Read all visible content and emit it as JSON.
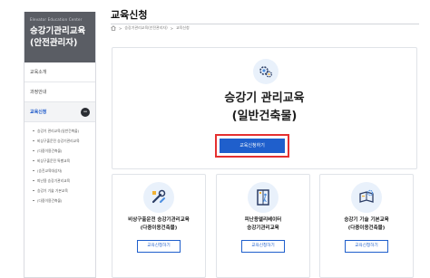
{
  "sidebar": {
    "subtitle": "Elevator Education Center",
    "title_line1": "승강기관리교육",
    "title_line2": "(안전관리자)",
    "items": [
      {
        "label": "교육소개"
      },
      {
        "label": "과정안내"
      },
      {
        "label": "교육신청",
        "toggle": "−"
      }
    ],
    "sub_items": [
      {
        "label": "승강기 관리교육(일반건축물)"
      },
      {
        "label": "비상구출운전 승강기관리교육"
      },
      {
        "label": "(다중이용건축물)"
      },
      {
        "label": "비상구출운전 특별교육"
      },
      {
        "label": "(승진교육대상자)"
      },
      {
        "label": "피난용 승강기관리교육"
      },
      {
        "label": "승강기 기술 기본교육"
      },
      {
        "label": "(다중이용건축물)"
      }
    ]
  },
  "header": {
    "title": "교육신청",
    "breadcrumb": [
      "승강기관리교육(안전관리자)",
      "교육신청"
    ],
    "breadcrumb_sep": ">"
  },
  "main": {
    "title_line1": "승강기 관리교육",
    "title_line2": "(일반건축물)",
    "button_label": "교육신청하기"
  },
  "cards": [
    {
      "title_line1": "비상구출운전 승강기관리교육",
      "title_line2": "(다중이용건축물)",
      "button_label": "교육신청하기",
      "icon": "elevator-repair-icon"
    },
    {
      "title_line1": "피난용엘리베이터",
      "title_line2": "승강기관리교육",
      "button_label": "교육신청하기",
      "icon": "evacuation-elevator-icon"
    },
    {
      "title_line1": "승강기 기술 기본교육",
      "title_line2": "(다중이용건축물)",
      "button_label": "교육신청하기",
      "icon": "book-gear-icon"
    }
  ],
  "colors": {
    "accent": "#1f5fcc",
    "highlight": "#e53030",
    "sidebar_head": "#5a5d64"
  }
}
